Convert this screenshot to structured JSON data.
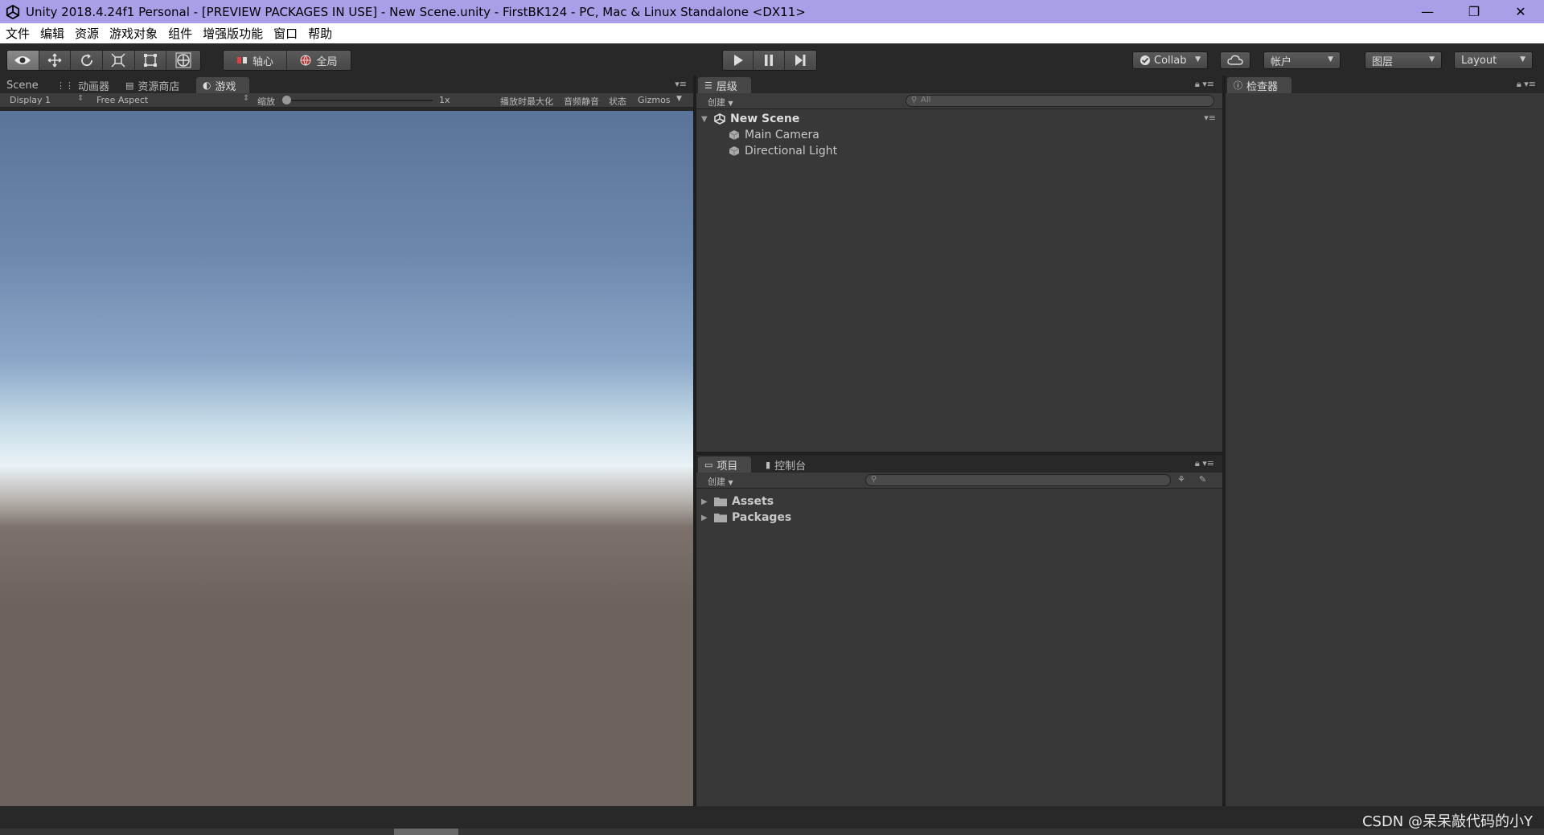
{
  "window": {
    "title": "Unity 2018.4.24f1 Personal - [PREVIEW PACKAGES IN USE] - New Scene.unity - FirstBK124 - PC, Mac & Linux Standalone <DX11>",
    "minimize": "—",
    "restore": "❐",
    "close": "✕"
  },
  "menu": [
    "文件",
    "编辑",
    "资源",
    "游戏对象",
    "组件",
    "增强版功能",
    "窗口",
    "帮助"
  ],
  "toolbar": {
    "pivot_label": "轴心",
    "global_label": "全局",
    "collab_label": "Collab",
    "account_label": "帐户",
    "layers_label": "图层",
    "layout_label": "Layout"
  },
  "left_panel": {
    "tabs": [
      "Scene",
      "动画器",
      "资源商店",
      "游戏"
    ],
    "display": "Display 1",
    "aspect": "Free Aspect",
    "scale_label": "缩放",
    "scale_value": "1x",
    "maximize_on_play": "播放时最大化",
    "mute_audio": "音频静音",
    "stats": "状态",
    "gizmos": "Gizmos"
  },
  "hierarchy": {
    "tab": "层级",
    "create": "创建",
    "search_placeholder": "All",
    "scene": "New Scene",
    "items": [
      "Main Camera",
      "Directional Light"
    ]
  },
  "project": {
    "tabs": [
      "项目",
      "控制台"
    ],
    "create": "创建",
    "items": [
      "Assets",
      "Packages"
    ]
  },
  "inspector": {
    "tab": "检查器"
  },
  "watermark": "CSDN @呆呆敲代码的小Y",
  "colors": {
    "titlebar": "#a99ee8",
    "sky_top": "#5a739b",
    "horizon": "#e9f2f6",
    "ground": "#6b625e",
    "panel": "#383838"
  }
}
